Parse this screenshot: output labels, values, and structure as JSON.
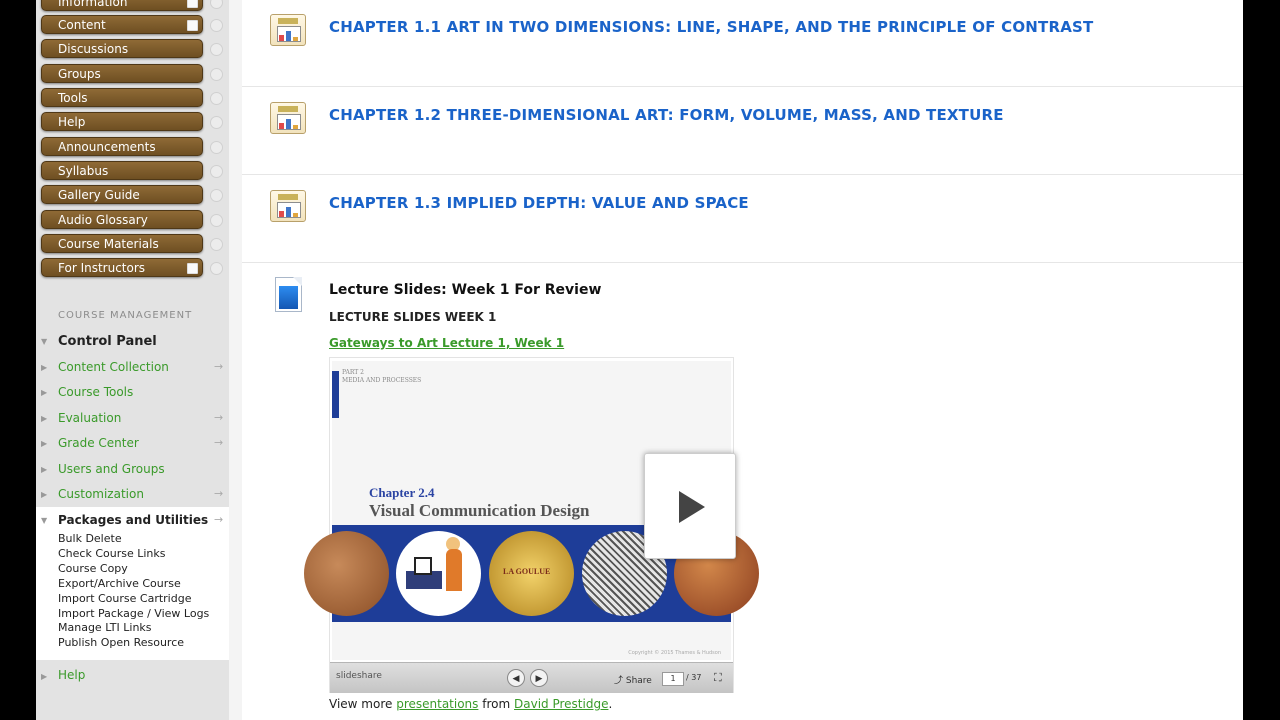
{
  "sidebar": {
    "menu": [
      {
        "label": "Information"
      },
      {
        "label": "Content"
      },
      {
        "label": "Discussions"
      },
      {
        "label": "Groups"
      },
      {
        "label": "Tools"
      },
      {
        "label": "Help"
      },
      {
        "label": "Announcements"
      },
      {
        "label": "Syllabus"
      },
      {
        "label": "Gallery Guide"
      },
      {
        "label": "Audio Glossary"
      },
      {
        "label": "Course Materials"
      },
      {
        "label": "For Instructors"
      }
    ],
    "course_management_label": "COURSE MANAGEMENT",
    "control_panel": {
      "title": "Control Panel",
      "items": [
        "Content Collection",
        "Course Tools",
        "Evaluation",
        "Grade Center",
        "Users and Groups",
        "Customization"
      ],
      "packages": {
        "title": "Packages and Utilities",
        "items": [
          "Bulk Delete",
          "Check Course Links",
          "Course Copy",
          "Export/Archive Course",
          "Import Course Cartridge",
          "Import Package / View Logs",
          "Manage LTI Links",
          "Publish Open Resource"
        ]
      },
      "help": "Help"
    }
  },
  "main": {
    "chapters": [
      {
        "title": "CHAPTER 1.1 ART IN TWO DIMENSIONS: LINE, SHAPE, AND THE PRINCIPLE OF CONTRAST"
      },
      {
        "title": "CHAPTER 1.2 THREE-DIMENSIONAL ART: FORM, VOLUME, MASS, AND TEXTURE"
      },
      {
        "title": "CHAPTER 1.3 IMPLIED DEPTH: VALUE AND SPACE"
      }
    ],
    "lecture": {
      "title": "Lecture Slides: Week 1 For Review",
      "subtitle": "LECTURE SLIDES WEEK 1",
      "link": "Gateways to Art Lecture 1, Week 1",
      "slide": {
        "part": "PART 2",
        "part_sub": "MEDIA AND PROCESSES",
        "chapter": "Chapter 2.4",
        "title": "Visual Communication Design",
        "poster_text": "LA GOULUE",
        "copyright": "Copyright © 2015 Thames & Hudson"
      },
      "player": {
        "logo": "slideshare",
        "share": "Share",
        "page": "1",
        "total": "/ 37",
        "prev": "◀",
        "next": "▶",
        "fullscreen": "⛶"
      },
      "view_more": {
        "prefix": "View more",
        "presentations": "presentations",
        "from": "from",
        "author": "David Prestidge",
        "end": "."
      }
    }
  },
  "colors": {
    "menu_button": "#7d5b2b",
    "link_green": "#3a9a2a",
    "chapter_blue": "#1a63c9",
    "slide_blue": "#1e3d98"
  }
}
